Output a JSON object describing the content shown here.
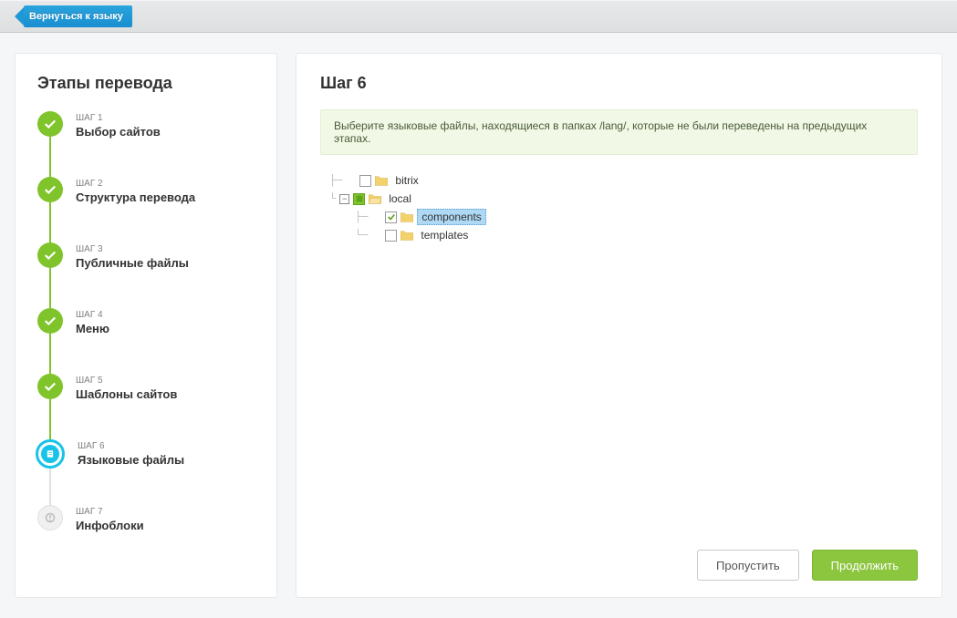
{
  "topbar": {
    "back_label": "Вернуться к языку"
  },
  "sidebar": {
    "title": "Этапы перевода",
    "steps": [
      {
        "label": "ШАГ 1",
        "title": "Выбор сайтов",
        "state": "done"
      },
      {
        "label": "ШАГ 2",
        "title": "Структура перевода",
        "state": "done"
      },
      {
        "label": "ШАГ 3",
        "title": "Публичные файлы",
        "state": "done"
      },
      {
        "label": "ШАГ 4",
        "title": "Меню",
        "state": "done"
      },
      {
        "label": "ШАГ 5",
        "title": "Шаблоны сайтов",
        "state": "done"
      },
      {
        "label": "ШАГ 6",
        "title": "Языковые файлы",
        "state": "current"
      },
      {
        "label": "ШАГ 7",
        "title": "Инфоблоки",
        "state": "pending"
      }
    ]
  },
  "main": {
    "title": "Шаг 6",
    "info": "Выберите языковые файлы, находящиеся в папках /lang/, которые не были переведены на предыдущих этапах.",
    "tree": {
      "bitrix": {
        "label": "bitrix",
        "checked": false,
        "expanded": false
      },
      "local": {
        "label": "local",
        "checked": "partial",
        "expanded": true,
        "components": {
          "label": "components",
          "checked": true,
          "selected": true
        },
        "templates": {
          "label": "templates",
          "checked": false
        }
      }
    },
    "skip_label": "Пропустить",
    "continue_label": "Продолжить"
  }
}
